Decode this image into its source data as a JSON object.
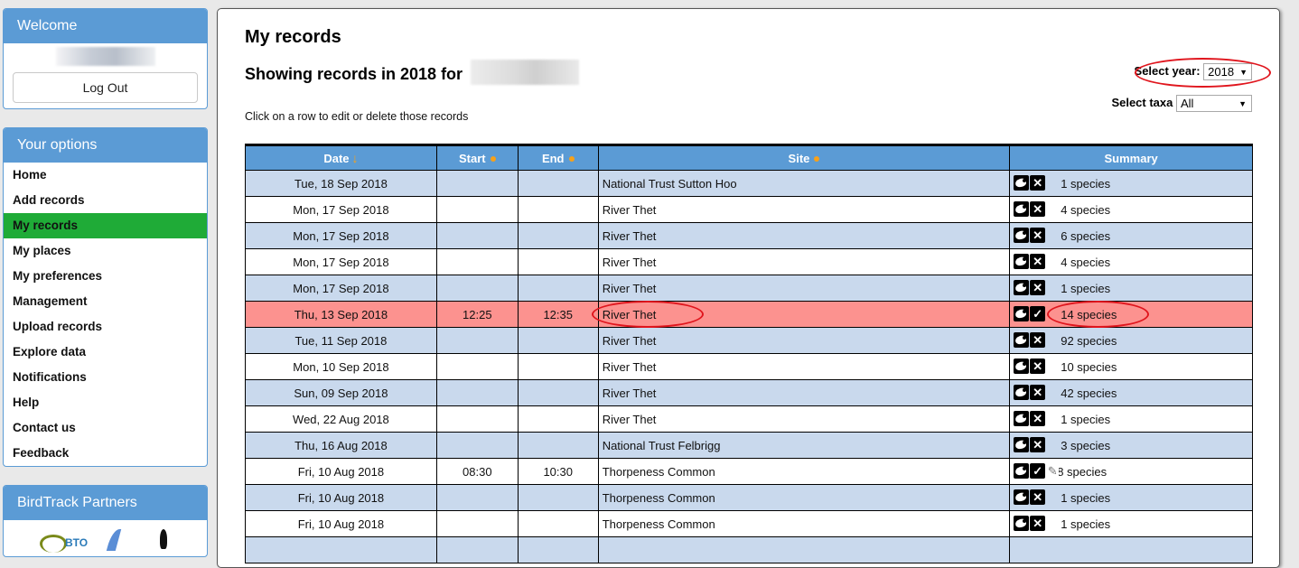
{
  "sidebar": {
    "welcome": {
      "title": "Welcome",
      "logout_label": "Log Out"
    },
    "options": {
      "title": "Your options",
      "items": [
        {
          "label": "Home",
          "active": false
        },
        {
          "label": "Add records",
          "active": false
        },
        {
          "label": "My records",
          "active": true
        },
        {
          "label": "My places",
          "active": false
        },
        {
          "label": "My preferences",
          "active": false
        },
        {
          "label": "Management",
          "active": false
        },
        {
          "label": "Upload records",
          "active": false
        },
        {
          "label": "Explore data",
          "active": false
        },
        {
          "label": "Notifications",
          "active": false
        },
        {
          "label": "Help",
          "active": false
        },
        {
          "label": "Contact us",
          "active": false
        },
        {
          "label": "Feedback",
          "active": false
        }
      ]
    },
    "partners": {
      "title": "BirdTrack Partners",
      "logo_text": "BTO"
    }
  },
  "main": {
    "title": "My records",
    "showing": "Showing records in 2018 for",
    "hint": "Click on a row to edit or delete those records",
    "year_filter": {
      "label": "Select year:",
      "value": "2018"
    },
    "taxa_filter": {
      "label": "Select taxa",
      "value": "All"
    },
    "table": {
      "columns": [
        {
          "label": "Date",
          "sort": "desc"
        },
        {
          "label": "Start",
          "sort": "none"
        },
        {
          "label": "End",
          "sort": "none"
        },
        {
          "label": "Site",
          "sort": "none"
        },
        {
          "label": "Summary",
          "sort": "none"
        }
      ],
      "rows": [
        {
          "date": "Tue, 18 Sep 2018",
          "start": "",
          "end": "",
          "site": "National Trust Sutton Hoo",
          "status": "incomplete",
          "note": false,
          "summary": "1 species"
        },
        {
          "date": "Mon, 17 Sep 2018",
          "start": "",
          "end": "",
          "site": "River Thet",
          "status": "incomplete",
          "note": false,
          "summary": "4 species"
        },
        {
          "date": "Mon, 17 Sep 2018",
          "start": "",
          "end": "",
          "site": "River Thet",
          "status": "incomplete",
          "note": false,
          "summary": "6 species"
        },
        {
          "date": "Mon, 17 Sep 2018",
          "start": "",
          "end": "",
          "site": "River Thet",
          "status": "incomplete",
          "note": false,
          "summary": "4 species"
        },
        {
          "date": "Mon, 17 Sep 2018",
          "start": "",
          "end": "",
          "site": "River Thet",
          "status": "incomplete",
          "note": false,
          "summary": "1 species"
        },
        {
          "date": "Thu, 13 Sep 2018",
          "start": "12:25",
          "end": "12:35",
          "site": "River Thet",
          "status": "complete",
          "note": false,
          "summary": "14 species",
          "highlighted": true
        },
        {
          "date": "Tue, 11 Sep 2018",
          "start": "",
          "end": "",
          "site": "River Thet",
          "status": "incomplete",
          "note": false,
          "summary": "92 species"
        },
        {
          "date": "Mon, 10 Sep 2018",
          "start": "",
          "end": "",
          "site": "River Thet",
          "status": "incomplete",
          "note": false,
          "summary": "10 species"
        },
        {
          "date": "Sun, 09 Sep 2018",
          "start": "",
          "end": "",
          "site": "River Thet",
          "status": "incomplete",
          "note": false,
          "summary": "42 species"
        },
        {
          "date": "Wed, 22 Aug 2018",
          "start": "",
          "end": "",
          "site": "River Thet",
          "status": "incomplete",
          "note": false,
          "summary": "1 species"
        },
        {
          "date": "Thu, 16 Aug 2018",
          "start": "",
          "end": "",
          "site": "National Trust Felbrigg",
          "status": "incomplete",
          "note": false,
          "summary": "3 species"
        },
        {
          "date": "Fri, 10 Aug 2018",
          "start": "08:30",
          "end": "10:30",
          "site": "Thorpeness Common",
          "status": "complete",
          "note": true,
          "summary": "8 species"
        },
        {
          "date": "Fri, 10 Aug 2018",
          "start": "",
          "end": "",
          "site": "Thorpeness Common",
          "status": "incomplete",
          "note": false,
          "summary": "1 species"
        },
        {
          "date": "Fri, 10 Aug 2018",
          "start": "",
          "end": "",
          "site": "Thorpeness Common",
          "status": "incomplete",
          "note": false,
          "summary": "1 species"
        },
        {
          "date": "",
          "start": "",
          "end": "",
          "site": "",
          "status": "incomplete",
          "note": false,
          "summary": ""
        }
      ]
    }
  },
  "icons": {
    "view": "eye-icon",
    "incomplete": "cross-icon",
    "complete": "check-icon",
    "note": "note-icon",
    "sort_desc": "↓",
    "check_glyph": "✓",
    "cross_glyph": "✕",
    "note_glyph": "✎",
    "dropdown_glyph": "▼"
  },
  "colors": {
    "header_blue": "#5b9bd5",
    "active_nav": "#1fab37",
    "row_alt": "#c9d9ed",
    "row_highlight": "#fc928f",
    "annotation_red": "#e0151d",
    "sort_orange": "#f7a11a"
  }
}
